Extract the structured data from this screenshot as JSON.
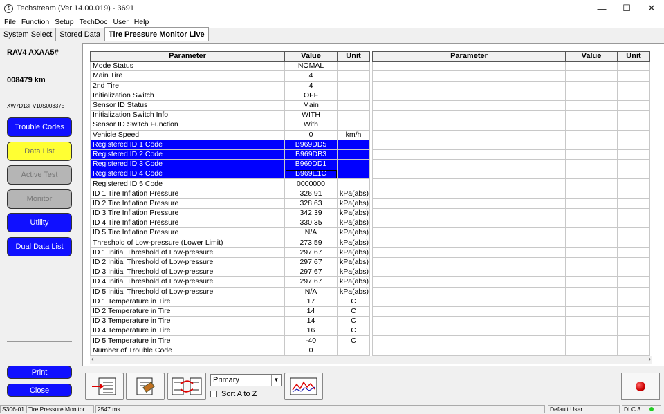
{
  "window": {
    "title": "Techstream (Ver 14.00.019) - 3691",
    "icon_letter": "t",
    "minimize": "—",
    "maximize": "☐",
    "close": "✕"
  },
  "menu": [
    "File",
    "Function",
    "Setup",
    "TechDoc",
    "User",
    "Help"
  ],
  "tabs": [
    "System Select",
    "Stored Data",
    "Tire Pressure Monitor Live"
  ],
  "sidebar": {
    "model": "RAV4 AXAA5#",
    "odometer": "008479 km",
    "vin": "XW7D13FV10S003375",
    "buttons": {
      "trouble_codes": "Trouble Codes",
      "data_list": "Data List",
      "active_test": "Active Test",
      "monitor": "Monitor",
      "utility": "Utility",
      "dual_data_list": "Dual Data List",
      "print": "Print",
      "close": "Close"
    }
  },
  "table": {
    "headers": {
      "parameter": "Parameter",
      "value": "Value",
      "unit": "Unit"
    },
    "rows": [
      {
        "parameter": "Mode Status",
        "value": "NOMAL",
        "unit": ""
      },
      {
        "parameter": "Main Tire",
        "value": "4",
        "unit": ""
      },
      {
        "parameter": "2nd Tire",
        "value": "4",
        "unit": ""
      },
      {
        "parameter": "Initialization Switch",
        "value": "OFF",
        "unit": ""
      },
      {
        "parameter": "Sensor ID Status",
        "value": "Main",
        "unit": ""
      },
      {
        "parameter": "Initialization Switch Info",
        "value": "WITH",
        "unit": ""
      },
      {
        "parameter": "Sensor ID Switch Function",
        "value": "With",
        "unit": ""
      },
      {
        "parameter": "Vehicle Speed",
        "value": "0",
        "unit": "km/h"
      },
      {
        "parameter": "Registered ID 1 Code",
        "value": "B969DD5",
        "unit": "",
        "selected": true
      },
      {
        "parameter": "Registered ID 2 Code",
        "value": "B969DB3",
        "unit": "",
        "selected": true
      },
      {
        "parameter": "Registered ID 3 Code",
        "value": "B969DD1",
        "unit": "",
        "selected": true
      },
      {
        "parameter": "Registered ID 4 Code",
        "value": "B969E1C",
        "unit": "",
        "selected": true,
        "focus": true
      },
      {
        "parameter": "Registered ID 5 Code",
        "value": "0000000",
        "unit": ""
      },
      {
        "parameter": "ID 1 Tire Inflation Pressure",
        "value": "326,91",
        "unit": "kPa(abs)"
      },
      {
        "parameter": "ID 2 Tire Inflation Pressure",
        "value": "328,63",
        "unit": "kPa(abs)"
      },
      {
        "parameter": "ID 3 Tire Inflation Pressure",
        "value": "342,39",
        "unit": "kPa(abs)"
      },
      {
        "parameter": "ID 4 Tire Inflation Pressure",
        "value": "330,35",
        "unit": "kPa(abs)"
      },
      {
        "parameter": "ID 5 Tire Inflation Pressure",
        "value": "N/A",
        "unit": "kPa(abs)"
      },
      {
        "parameter": "Threshold of Low-pressure (Lower Limit)",
        "value": "273,59",
        "unit": "kPa(abs)"
      },
      {
        "parameter": "ID 1 Initial Threshold of Low-pressure",
        "value": "297,67",
        "unit": "kPa(abs)"
      },
      {
        "parameter": "ID 2 Initial Threshold of Low-pressure",
        "value": "297,67",
        "unit": "kPa(abs)"
      },
      {
        "parameter": "ID 3 Initial Threshold of Low-pressure",
        "value": "297,67",
        "unit": "kPa(abs)"
      },
      {
        "parameter": "ID 4 Initial Threshold of Low-pressure",
        "value": "297,67",
        "unit": "kPa(abs)"
      },
      {
        "parameter": "ID 5 Initial Threshold of Low-pressure",
        "value": "N/A",
        "unit": "kPa(abs)"
      },
      {
        "parameter": "ID 1 Temperature in Tire",
        "value": "17",
        "unit": "C"
      },
      {
        "parameter": "ID 2 Temperature in Tire",
        "value": "14",
        "unit": "C"
      },
      {
        "parameter": "ID 3 Temperature in Tire",
        "value": "14",
        "unit": "C"
      },
      {
        "parameter": "ID 4 Temperature in Tire",
        "value": "16",
        "unit": "C"
      },
      {
        "parameter": "ID 5 Temperature in Tire",
        "value": "-40",
        "unit": "C"
      },
      {
        "parameter": "Number of Trouble Code",
        "value": "0",
        "unit": ""
      }
    ]
  },
  "toolbar": {
    "select_value": "Primary",
    "sort_label": "Sort A to Z"
  },
  "statusbar": {
    "code": "S306-01",
    "screen": "Tire Pressure Monitor",
    "time": "2547 ms",
    "user": "Default User",
    "dlc": "DLC 3"
  }
}
